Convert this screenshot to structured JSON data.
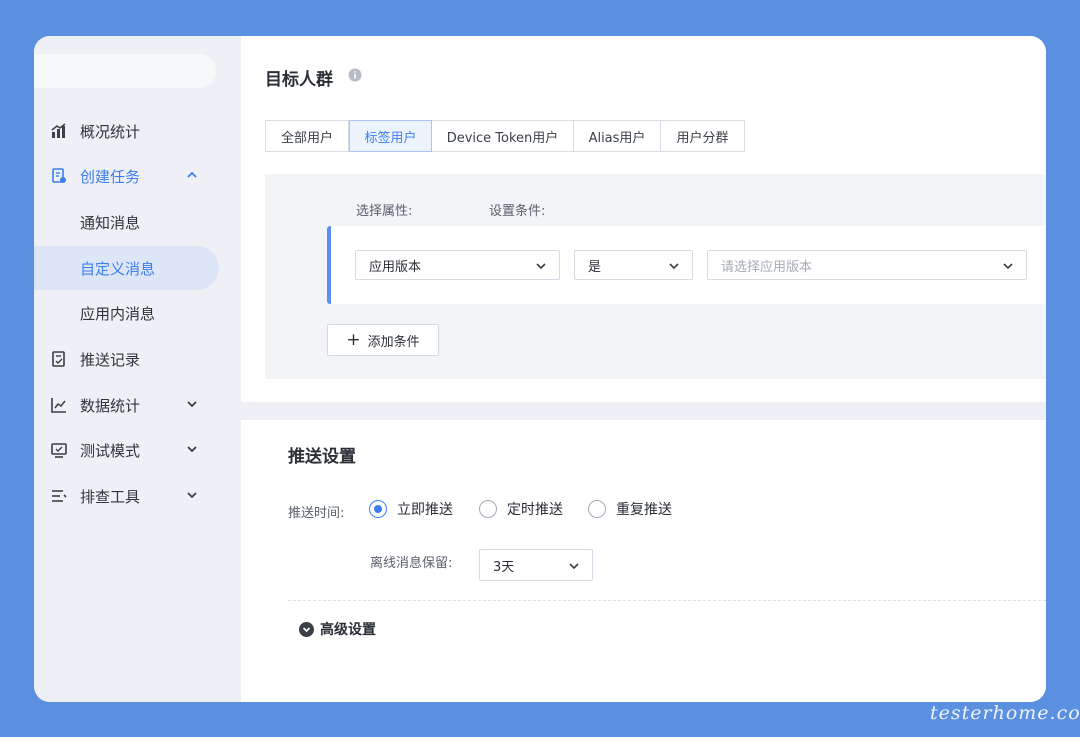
{
  "sidebar": {
    "items": [
      {
        "label": "概况统计",
        "icon": "bar-chart-icon"
      },
      {
        "label": "创建任务",
        "icon": "task-doc-icon",
        "expanded": true
      },
      {
        "label": "推送记录",
        "icon": "record-doc-icon"
      },
      {
        "label": "数据统计",
        "icon": "line-chart-icon"
      },
      {
        "label": "测试模式",
        "icon": "monitor-icon"
      },
      {
        "label": "排查工具",
        "icon": "list-tool-icon"
      }
    ],
    "sub_items": [
      {
        "label": "通知消息"
      },
      {
        "label": "自定义消息",
        "selected": true
      },
      {
        "label": "应用内消息"
      }
    ]
  },
  "target": {
    "title": "目标人群",
    "tabs": [
      {
        "label": "全部用户"
      },
      {
        "label": "标签用户",
        "active": true
      },
      {
        "label": "Device Token用户"
      },
      {
        "label": "Alias用户"
      },
      {
        "label": "用户分群"
      }
    ],
    "attr_header": "选择属性:",
    "cond_header": "设置条件:",
    "attribute_value": "应用版本",
    "operator_value": "是",
    "version_placeholder": "请选择应用版本",
    "add_condition": "添加条件"
  },
  "push": {
    "title": "推送设置",
    "time_label": "推送时间:",
    "options": [
      {
        "label": "立即推送",
        "checked": true
      },
      {
        "label": "定时推送",
        "checked": false
      },
      {
        "label": "重复推送",
        "checked": false
      }
    ],
    "offline_label": "离线消息保留:",
    "offline_value": "3天",
    "advanced": "高级设置"
  },
  "watermark": "testerhome.com",
  "colors": {
    "background": "#5b8fe0",
    "accent": "#3d7ef2",
    "sidebar": "#eef0f5"
  }
}
